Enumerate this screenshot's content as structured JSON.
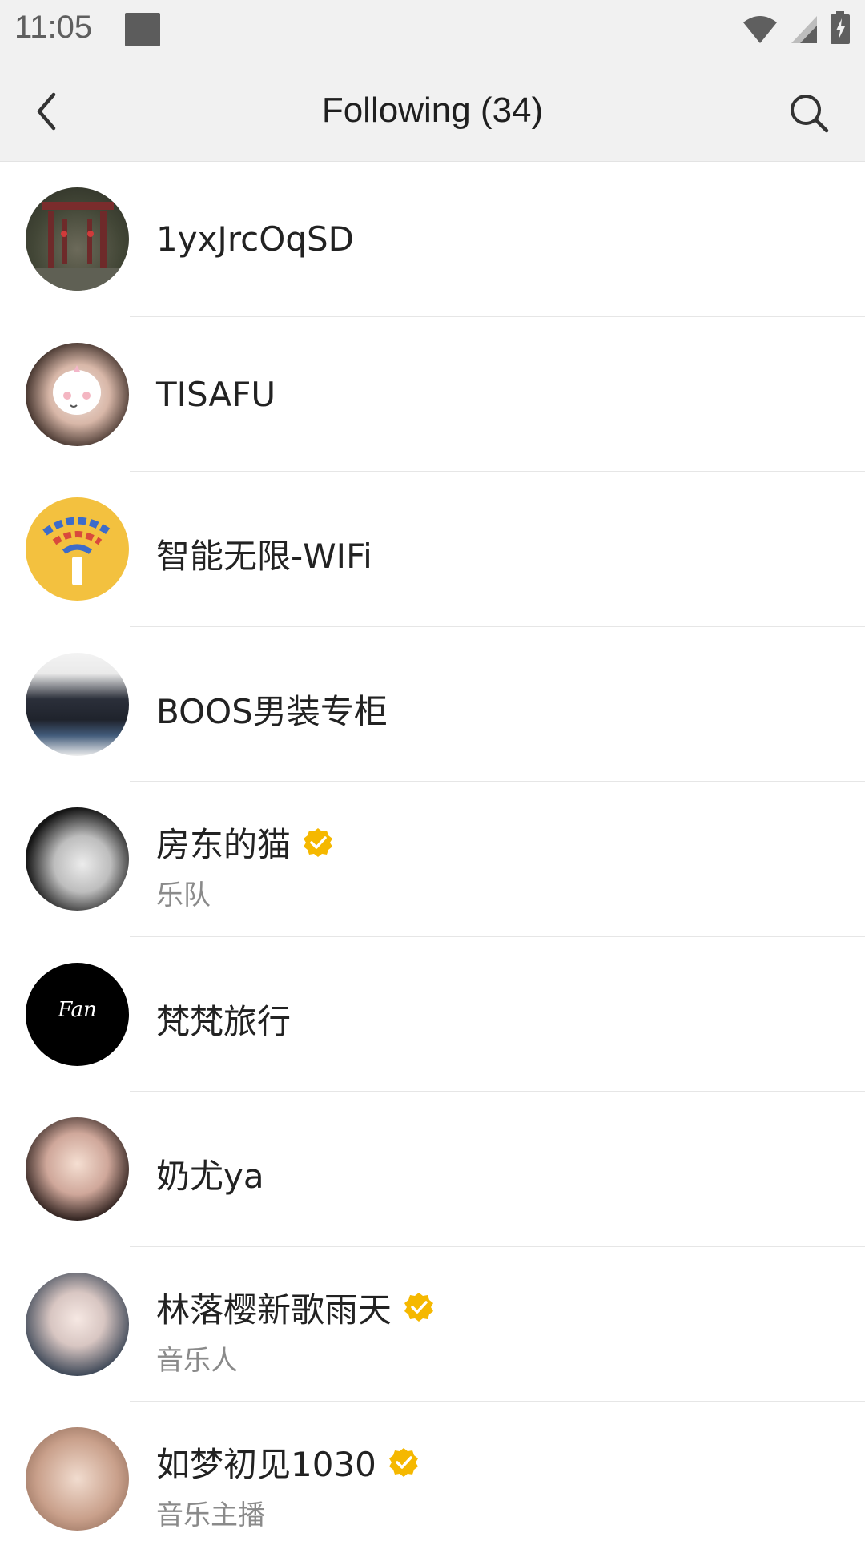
{
  "status_bar": {
    "time": "11:05"
  },
  "header": {
    "title": "Following (34)"
  },
  "colors": {
    "verified_badge": "#F5B800",
    "header_bg": "#f1f1f1",
    "wifi_avatar_bg": "#f3c13f"
  },
  "list": [
    {
      "name": "1yxJrcOqSD",
      "subtitle": "",
      "verified": false,
      "avatar_icon": "gate-photo-avatar"
    },
    {
      "name": "TISAFU",
      "subtitle": "",
      "verified": false,
      "avatar_icon": "girl-sticker-avatar"
    },
    {
      "name": "智能无限-WIFi",
      "subtitle": "",
      "verified": false,
      "avatar_icon": "wifi-logo-avatar"
    },
    {
      "name": "BOOS男装专柜",
      "subtitle": "",
      "verified": false,
      "avatar_icon": "clothes-avatar"
    },
    {
      "name": "房东的猫",
      "subtitle": "乐队",
      "verified": true,
      "avatar_icon": "band-photo-avatar"
    },
    {
      "name": "梵梵旅行",
      "subtitle": "",
      "verified": false,
      "avatar_icon": "fan-logo-avatar",
      "avatar_text": "Fan"
    },
    {
      "name": "奶尤ya",
      "subtitle": "",
      "verified": false,
      "avatar_icon": "portrait-avatar"
    },
    {
      "name": "林落樱新歌雨天",
      "subtitle": "音乐人",
      "verified": true,
      "avatar_icon": "portrait-avatar"
    },
    {
      "name": "如梦初见1030",
      "subtitle": "音乐主播",
      "verified": true,
      "avatar_icon": "portrait-avatar"
    }
  ]
}
